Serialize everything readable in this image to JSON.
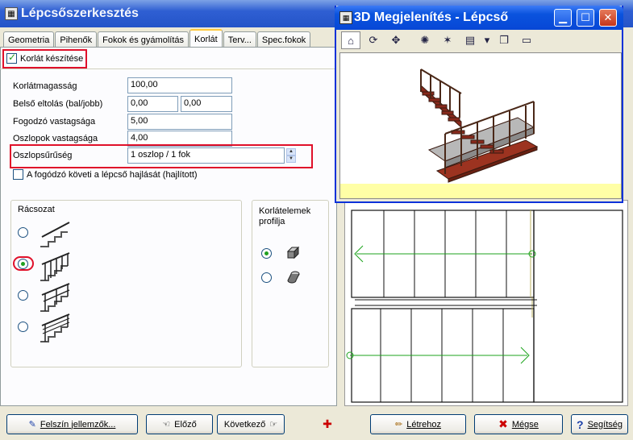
{
  "window": {
    "title": "Lépcsőszerkesztés"
  },
  "tabs": [
    {
      "label": "Geometria"
    },
    {
      "label": "Pihenők"
    },
    {
      "label": "Fokok és gyámolítás"
    },
    {
      "label": "Korlát"
    },
    {
      "label": "Terv..."
    },
    {
      "label": "Spec.fokok"
    }
  ],
  "korlat": {
    "create_label": "Korlát készítése",
    "create_checked": true,
    "fields": {
      "height": {
        "label": "Korlátmagasság",
        "value": "100,00"
      },
      "offset": {
        "label": "Belső eltolás (bal/jobb)",
        "value_left": "0,00",
        "value_right": "0,00"
      },
      "handrail": {
        "label": "Fogodzó vastagsága",
        "value": "5,00"
      },
      "post": {
        "label": "Oszlopok vastagsága",
        "value": "4,00"
      },
      "density": {
        "label": "Oszlopsűrűség",
        "value": "1 oszlop / 1 fok"
      }
    },
    "follow_label": "A fogódzó követi a lépcső hajlását (hajlított)",
    "follow_checked": false,
    "lattice": {
      "label": "Rácsozat",
      "selected_index": 1
    },
    "profile": {
      "label_line1": "Korlátelemek",
      "label_line2": "profilja",
      "selected_index": 0
    }
  },
  "view3d": {
    "title": "3D Megjelenítés - Lépcső",
    "tools": [
      "home-icon",
      "orbit-icon",
      "pan-icon",
      "render-icon",
      "light-icon",
      "calculator-icon",
      "window-icon",
      "ruler-icon"
    ]
  },
  "buttons": {
    "surface": "Felszín jellemzők...",
    "prev": "Előző",
    "next": "Következő",
    "create": "Létrehoz",
    "cancel": "Mégse",
    "help": "Segítség"
  }
}
